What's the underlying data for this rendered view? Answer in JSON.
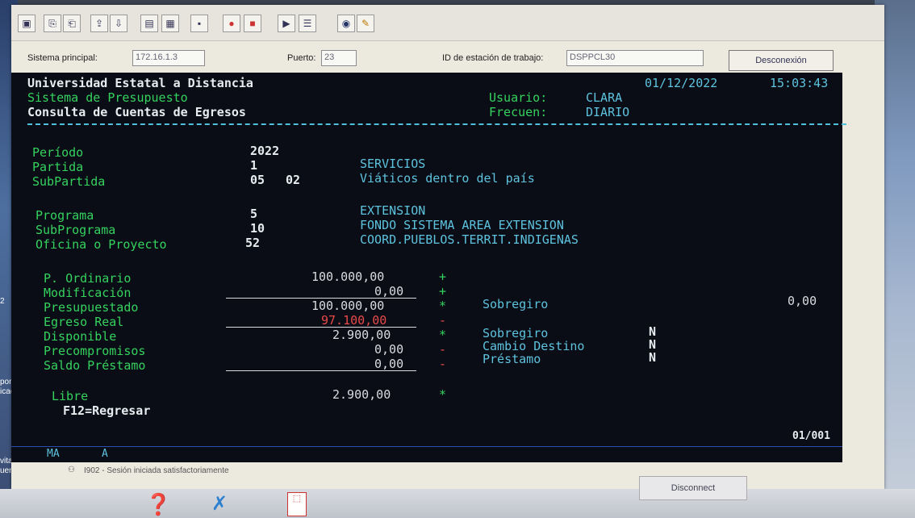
{
  "desktop": {
    "icon_labels": [
      "2",
      "porte",
      "icados",
      "vitacion",
      "uentro i..."
    ]
  },
  "toolbar": {
    "buttons": [
      "screen-icon",
      "copy-icon",
      "paste-icon",
      "send-icon",
      "receive-icon",
      "print-icon",
      "record-icon",
      "play-icon",
      "macro-icon",
      "macro-stop-icon",
      "globe-icon",
      "key-icon"
    ]
  },
  "connection": {
    "host_label": "Sistema principal:",
    "host_value": "172.16.1.3",
    "port_label": "Puerto:",
    "port_value": "23",
    "workstation_label": "ID de estación de trabajo:",
    "workstation_value": "DSPPCL30",
    "disconnect_label": "Desconexión"
  },
  "terminal": {
    "org": "Universidad Estatal a Distancia",
    "date": "01/12/2022",
    "time": "15:03:43",
    "system": "Sistema de Presupuesto",
    "user_label": "Usuario:",
    "user_value": "CLARA",
    "screen_title": "Consulta de Cuentas de Egresos",
    "freq_label": "Frecuen:",
    "freq_value": "DIARIO",
    "periodo_label": "Período",
    "periodo_value": "2022",
    "partida_label": "Partida",
    "partida_value": "1",
    "partida_desc": "SERVICIOS",
    "subpartida_label": "SubPartida",
    "subpartida_value1": "05",
    "subpartida_value2": "02",
    "subpartida_desc": "Viáticos dentro del país",
    "programa_label": "Programa",
    "programa_value": "5",
    "programa_desc": "EXTENSION",
    "subprograma_label": "SubPrograma",
    "subprograma_value": "10",
    "subprograma_desc": "FONDO SISTEMA AREA EXTENSION",
    "oficina_label": "Oficina o Proyecto",
    "oficina_value": "52",
    "oficina_desc": "COORD.PUEBLOS.TERRIT.INDIGENAS",
    "amounts": {
      "ordinario_label": "P. Ordinario",
      "ordinario_value": "100.000,00",
      "ordinario_op": "+",
      "modificacion_label": "Modificación",
      "modificacion_value": "0,00",
      "modificacion_op": "+",
      "presupuestado_label": "Presupuestado",
      "presupuestado_value": "100.000,00",
      "presupuestado_op": "*",
      "egreso_label": "Egreso Real",
      "egreso_value": "97.100,00",
      "egreso_op": "-",
      "disponible_label": "Disponible",
      "disponible_value": "2.900,00",
      "disponible_op": "*",
      "precomp_label": "Precompromisos",
      "precomp_value": "0,00",
      "precomp_op": "-",
      "saldo_label": "Saldo Préstamo",
      "saldo_value": "0,00",
      "saldo_op": "-",
      "libre_label": "Libre",
      "libre_value": "2.900,00",
      "libre_op": "*"
    },
    "sobregiro1_label": "Sobregiro",
    "sobregiro1_value": "0,00",
    "sobregiro2_label": "Sobregiro",
    "sobregiro2_value": "N",
    "cambio_label": "Cambio Destino",
    "cambio_value": "N",
    "prestamo_label": "Préstamo",
    "prestamo_value": "N",
    "f12": "F12=Regresar",
    "page_indicator": "01/001"
  },
  "status": {
    "mode1": "MA",
    "mode2": "A",
    "message": "I902 - Sesión iniciada satisfactoriamente"
  },
  "taskbar": {
    "disconnect_label": "Disconnect"
  },
  "colors": {
    "terminal_bg": "#0a0d16",
    "green": "#35d25e",
    "white": "#e6ecef",
    "blue": "#5ec3de",
    "red": "#e84a4a"
  }
}
